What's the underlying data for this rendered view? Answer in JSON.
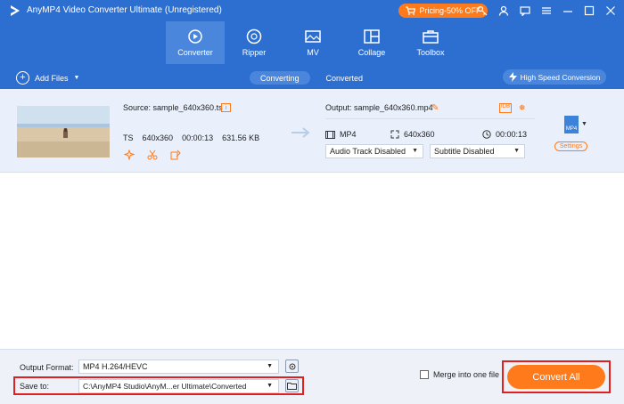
{
  "app": {
    "title": "AnyMP4 Video Converter Ultimate (Unregistered)",
    "pricing_label": "Pricing-50% OFF"
  },
  "nav": {
    "tabs": [
      {
        "label": "Converter",
        "icon": "converter-icon",
        "active": true
      },
      {
        "label": "Ripper",
        "icon": "ripper-icon",
        "active": false
      },
      {
        "label": "MV",
        "icon": "mv-icon",
        "active": false
      },
      {
        "label": "Collage",
        "icon": "collage-icon",
        "active": false
      },
      {
        "label": "Toolbox",
        "icon": "toolbox-icon",
        "active": false
      }
    ]
  },
  "subbar": {
    "add_files": "Add Files",
    "tabs": [
      "Converting",
      "Converted"
    ],
    "active_tab": "Converting",
    "high_speed": "High Speed Conversion"
  },
  "file": {
    "source": "Source: sample_640x360.ts",
    "src_format": "TS",
    "src_resolution": "640x360",
    "src_duration": "00:00:13",
    "src_size": "631.56 KB",
    "output": "Output: sample_640x360.mp4",
    "out_format": "MP4",
    "out_resolution": "640x360",
    "out_duration": "00:00:13",
    "audio_track": "Audio Track Disabled",
    "subtitle": "Subtitle Disabled",
    "format_badge": "MP4",
    "settings": "Settings"
  },
  "bottom": {
    "output_format_label": "Output Format:",
    "output_format_value": "MP4 H.264/HEVC",
    "save_to_label": "Save to:",
    "save_to_value": "C:\\AnyMP4 Studio\\AnyM...er Ultimate\\Converted",
    "merge_label": "Merge into one file",
    "convert_all": "Convert All"
  },
  "colors": {
    "header_blue": "#2d6fd0",
    "accent_orange": "#ff7a1a",
    "row_bg": "#e9f0fb",
    "highlight_red": "#e02020"
  }
}
